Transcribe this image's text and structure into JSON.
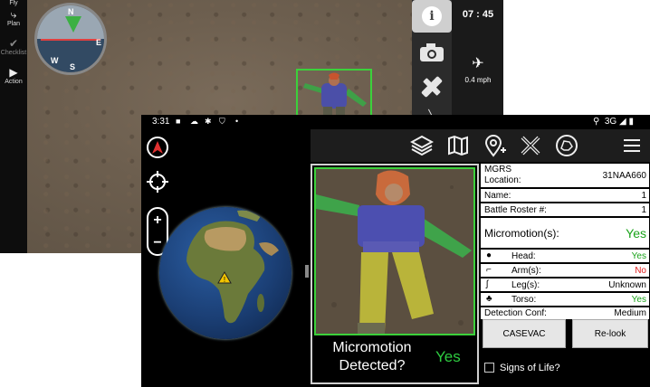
{
  "drone": {
    "nav": [
      {
        "label": "Fly",
        "icon": "fly-icon"
      },
      {
        "label": "Plan",
        "icon": "plan-icon"
      },
      {
        "label": "Checklist",
        "icon": "checklist-icon"
      },
      {
        "label": "Action",
        "icon": "play-icon"
      }
    ],
    "compass": {
      "n": "N",
      "e": "E",
      "s": "S",
      "w": "W"
    },
    "time": "07 : 45",
    "speed": "0.4 mph",
    "buttons": [
      "info-icon",
      "camera-icon",
      "satellite-icon"
    ]
  },
  "status_bar": {
    "time": "3:31",
    "network": "3G"
  },
  "toolbar": {
    "icons": [
      "layers-icon",
      "map-icon",
      "add-location-icon",
      "close-x-icon",
      "compass-dog-icon",
      "menu-icon"
    ]
  },
  "detection": {
    "micromotion_label": "Micromotion Detected?",
    "micromotion_value": "Yes"
  },
  "panel": {
    "mgrs_label": "MGRS Location:",
    "mgrs_value": "31NAA660",
    "name_label": "Name:",
    "name_value": "1",
    "roster_label": "Battle Roster #:",
    "roster_value": "1",
    "micromotion_label": "Micromotion(s):",
    "micromotion_value": "Yes",
    "head_label": "Head:",
    "head_value": "Yes",
    "arm_label": "Arm(s):",
    "arm_value": "No",
    "leg_label": "Leg(s):",
    "leg_value": "Unknown",
    "torso_label": "Torso:",
    "torso_value": "Yes",
    "conf_label": "Detection Conf:",
    "conf_value": "Medium",
    "casevac_label": "CASEVAC",
    "relook_label": "Re-look",
    "signs_of_life_label": "Signs of Life?"
  },
  "colors": {
    "detection_box": "#3bd13b",
    "yes": "#1aa31a",
    "no": "#e02020"
  }
}
